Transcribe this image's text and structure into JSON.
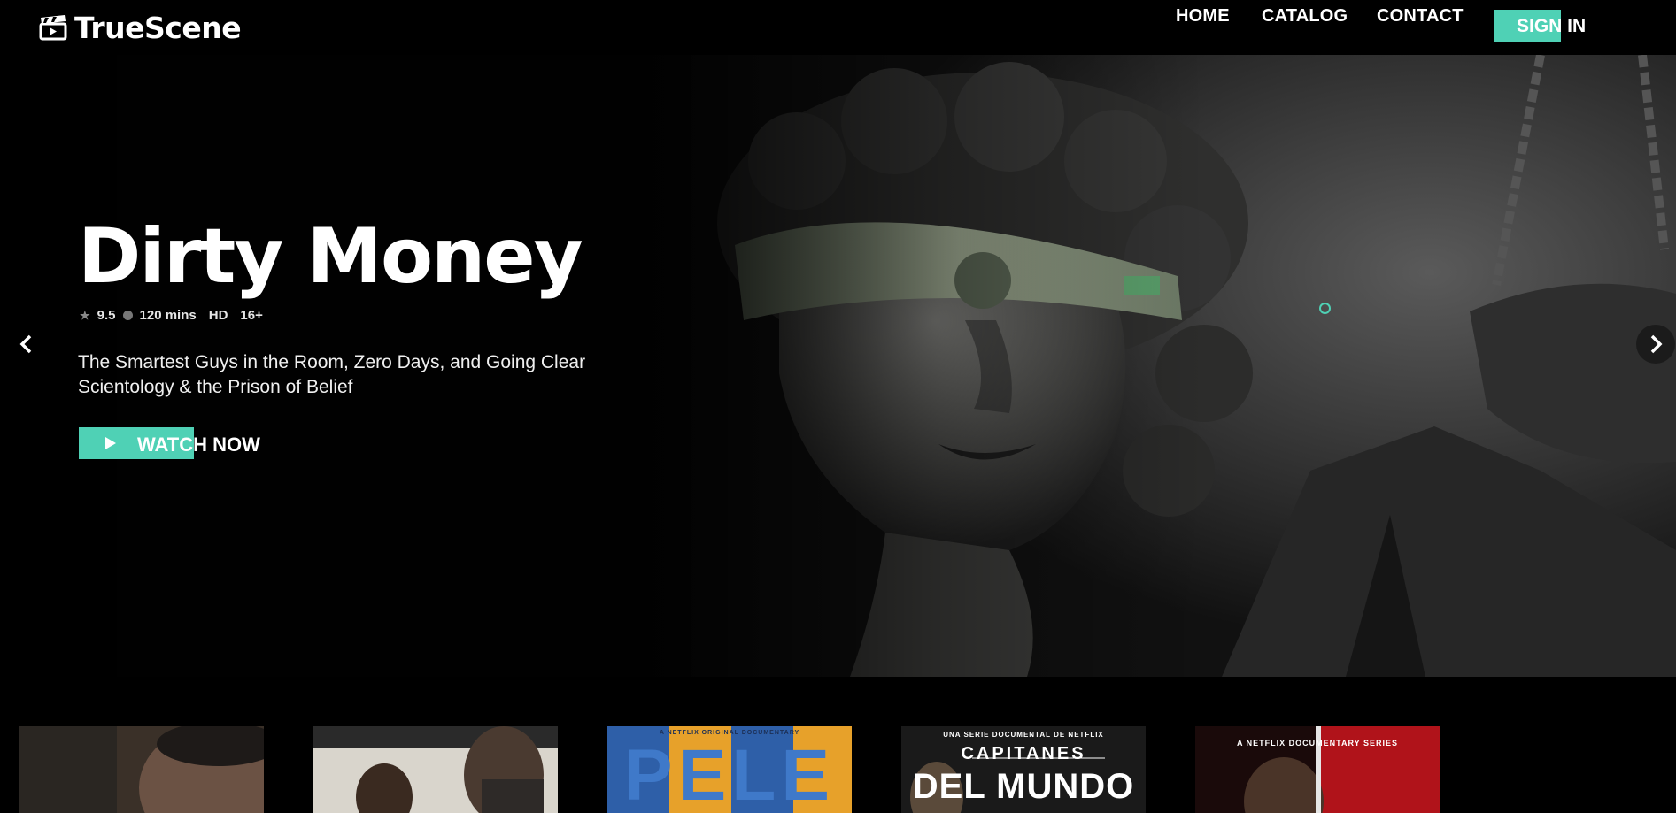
{
  "header": {
    "brand": "TrueScene",
    "nav": [
      {
        "label": "HOME"
      },
      {
        "label": "CATALOG"
      },
      {
        "label": "CONTACT"
      }
    ],
    "signin_label": "SIGN IN"
  },
  "hero": {
    "title": "Dirty Money",
    "rating": "9.5",
    "duration": "120 mins",
    "quality": "HD",
    "age": "16+",
    "description": "The Smartest Guys in the Room, Zero Days, and Going Clear Scientology & the Prison of Belief",
    "cta_label": "WATCH NOW"
  },
  "cards": [
    {
      "title": ""
    },
    {
      "title": ""
    },
    {
      "title": "PELE",
      "tag": "A NETFLIX ORIGINAL DOCUMENTARY"
    },
    {
      "title": "CAPITANES DEL MUNDO",
      "line1": "CAPITANES",
      "line2": "DEL MUNDO",
      "tag": "UNA SERIE DOCUMENTAL DE NETFLIX"
    },
    {
      "title": "",
      "tag": "A NETFLIX DOCUMENTARY SERIES"
    }
  ],
  "colors": {
    "accent": "#4fd1b5",
    "background": "#000000"
  }
}
